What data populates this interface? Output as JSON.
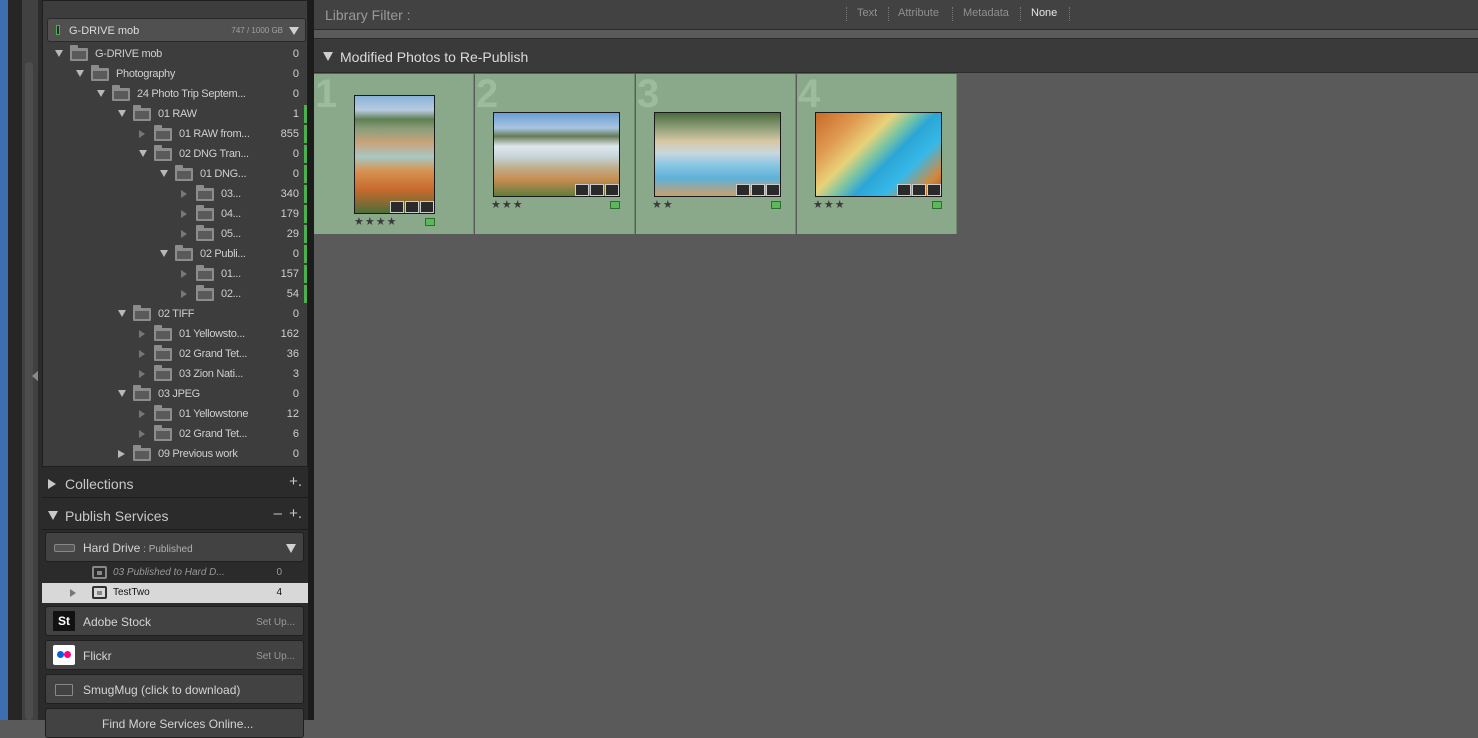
{
  "volume": {
    "name": "G-DRIVE mob",
    "capacity": "747 / 1000 GB"
  },
  "folders": [
    {
      "label": "G-DRIVE mob",
      "count": "0",
      "state": "open",
      "depth": 0,
      "bar": false
    },
    {
      "label": "Photography",
      "count": "0",
      "state": "open",
      "depth": 1,
      "bar": false
    },
    {
      "label": "24 Photo Trip Septem...",
      "count": "0",
      "state": "open",
      "depth": 2,
      "bar": false
    },
    {
      "label": "01 RAW",
      "count": "1",
      "state": "open",
      "depth": 3,
      "bar": true
    },
    {
      "label": "01 RAW from...",
      "count": "855",
      "state": "hollow",
      "depth": 4,
      "bar": true
    },
    {
      "label": "02 DNG Tran...",
      "count": "0",
      "state": "open",
      "depth": 4,
      "bar": true
    },
    {
      "label": "01 DNG...",
      "count": "0",
      "state": "open",
      "depth": 5,
      "bar": true
    },
    {
      "label": "03...",
      "count": "340",
      "state": "hollow",
      "depth": 6,
      "bar": true
    },
    {
      "label": "04...",
      "count": "179",
      "state": "hollow",
      "depth": 6,
      "bar": true
    },
    {
      "label": "05...",
      "count": "29",
      "state": "hollow",
      "depth": 6,
      "bar": true
    },
    {
      "label": "02 Publi...",
      "count": "0",
      "state": "open",
      "depth": 5,
      "bar": true
    },
    {
      "label": "01...",
      "count": "157",
      "state": "hollow",
      "depth": 6,
      "bar": true
    },
    {
      "label": "02...",
      "count": "54",
      "state": "hollow",
      "depth": 6,
      "bar": true
    },
    {
      "label": "02 TIFF",
      "count": "0",
      "state": "open",
      "depth": 3,
      "bar": false
    },
    {
      "label": "01 Yellowsto...",
      "count": "162",
      "state": "hollow",
      "depth": 4,
      "bar": false
    },
    {
      "label": "02 Grand Tet...",
      "count": "36",
      "state": "hollow",
      "depth": 4,
      "bar": false
    },
    {
      "label": "03 Zion Nati...",
      "count": "3",
      "state": "hollow",
      "depth": 4,
      "bar": false
    },
    {
      "label": "03 JPEG",
      "count": "0",
      "state": "open",
      "depth": 3,
      "bar": false
    },
    {
      "label": "01 Yellowstone",
      "count": "12",
      "state": "hollow",
      "depth": 4,
      "bar": false
    },
    {
      "label": "02 Grand Tet...",
      "count": "6",
      "state": "hollow",
      "depth": 4,
      "bar": false
    },
    {
      "label": "09 Previous work",
      "count": "0",
      "state": "closed",
      "depth": 3,
      "bar": false
    }
  ],
  "collections": {
    "label": "Collections",
    "plus": "+."
  },
  "publish": {
    "label": "Publish Services",
    "minus": "–",
    "plus": "+.",
    "hard_drive": {
      "name": "Hard Drive",
      "sep": " : ",
      "status": "Published"
    },
    "rows": [
      {
        "label": "03 Published to Hard D...",
        "count": "0"
      },
      {
        "label": "TestTwo",
        "count": "4"
      }
    ],
    "services": [
      {
        "name": "Adobe Stock",
        "icon": "St",
        "setup": "Set Up..."
      },
      {
        "name": "Flickr",
        "icon": "flickr",
        "setup": "Set Up..."
      },
      {
        "name": "SmugMug (click to download)",
        "icon": "folder",
        "setup": ""
      },
      {
        "name": "Find More Services Online...",
        "icon": "",
        "setup": ""
      }
    ]
  },
  "filter": {
    "label": "Library Filter :",
    "tabs": [
      "Text",
      "Attribute",
      "Metadata",
      "None"
    ],
    "active": "None"
  },
  "collection_header": "Modified Photos to Re-Publish",
  "photos": [
    {
      "num": "1",
      "stars": "★★★★",
      "label": "green"
    },
    {
      "num": "2",
      "stars": "★★★",
      "label": "green"
    },
    {
      "num": "3",
      "stars": "★★",
      "label": "green"
    },
    {
      "num": "4",
      "stars": "★★★",
      "label": "green"
    }
  ],
  "colors": {
    "accent_green": "#4caf50",
    "cell_bg": "#8aa98a",
    "selected_row": "#d8d8d8"
  }
}
